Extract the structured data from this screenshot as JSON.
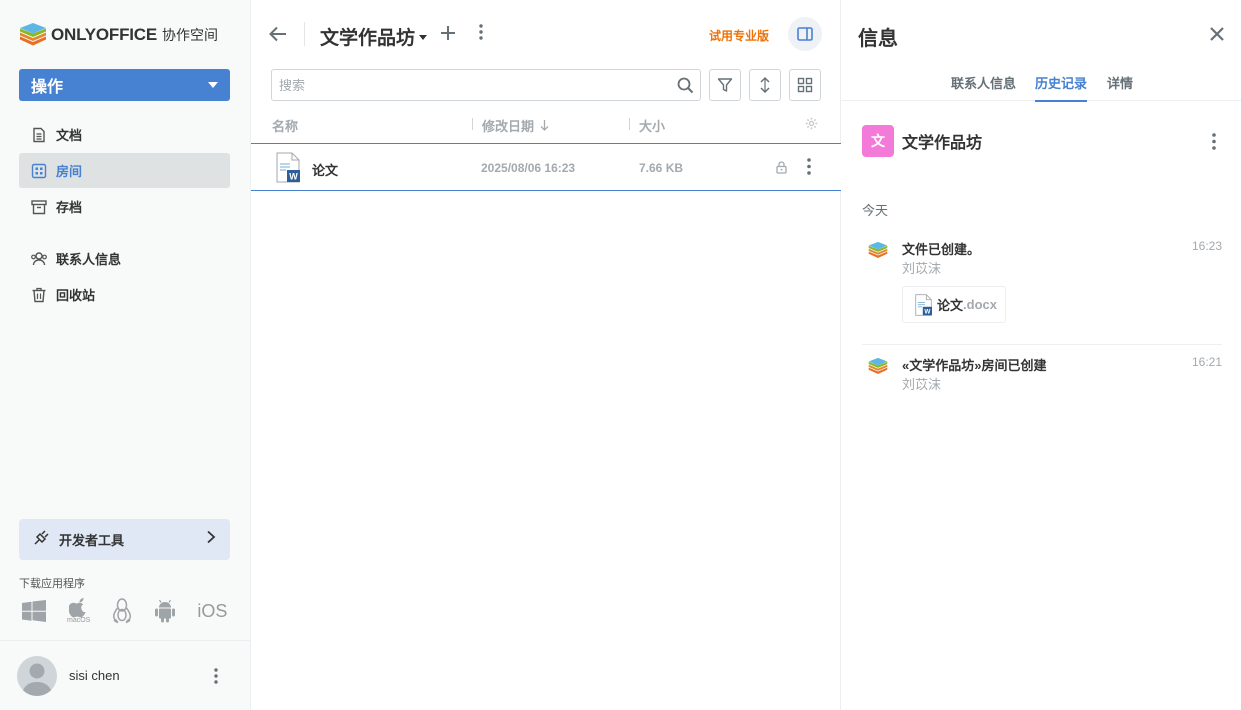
{
  "brand": {
    "name": "ONLYOFFICE",
    "sub": "协作空间"
  },
  "sidebar": {
    "actions_label": "操作",
    "items": [
      {
        "label": "文档",
        "icon": "document-icon"
      },
      {
        "label": "房间",
        "icon": "rooms-icon"
      },
      {
        "label": "存档",
        "icon": "archive-icon"
      },
      {
        "label": "联系人信息",
        "icon": "contacts-icon"
      },
      {
        "label": "回收站",
        "icon": "trash-icon"
      }
    ],
    "active_item": "房间",
    "devtools_label": "开发者工具",
    "download_label": "下载应用程序",
    "apps": [
      "windows",
      "macOS",
      "linux",
      "android",
      "iOS"
    ],
    "macos_label": "macOS",
    "ios_label": "iOS"
  },
  "user": {
    "name": "sisi chen"
  },
  "main": {
    "room_title": "文学作品坊",
    "trial_label": "试用专业版",
    "search_placeholder": "搜索",
    "columns": {
      "name": "名称",
      "modified": "修改日期",
      "size": "大小"
    },
    "files": [
      {
        "name": "论文",
        "modified": "2025/08/06 16:23",
        "size": "7.66 KB",
        "type": "docx"
      }
    ]
  },
  "info": {
    "title": "信息",
    "tabs": [
      "联系人信息",
      "历史记录",
      "详情"
    ],
    "active_tab": "历史记录",
    "room": {
      "logo_char": "文",
      "name": "文学作品坊",
      "logo_color": "#f47ad9"
    },
    "today_label": "今天",
    "history": [
      {
        "title": "文件已创建。",
        "author": "刘苡沫",
        "time": "16:23",
        "file_name": "论文",
        "file_ext": ".docx"
      },
      {
        "title": "«文学作品坊»房间已创建",
        "author": "刘苡沫",
        "time": "16:21"
      }
    ]
  },
  "colors": {
    "accent": "#4781d1",
    "trial": "#ed7309",
    "muted": "#a3a9ae",
    "room_logo": "#f47ad9"
  }
}
